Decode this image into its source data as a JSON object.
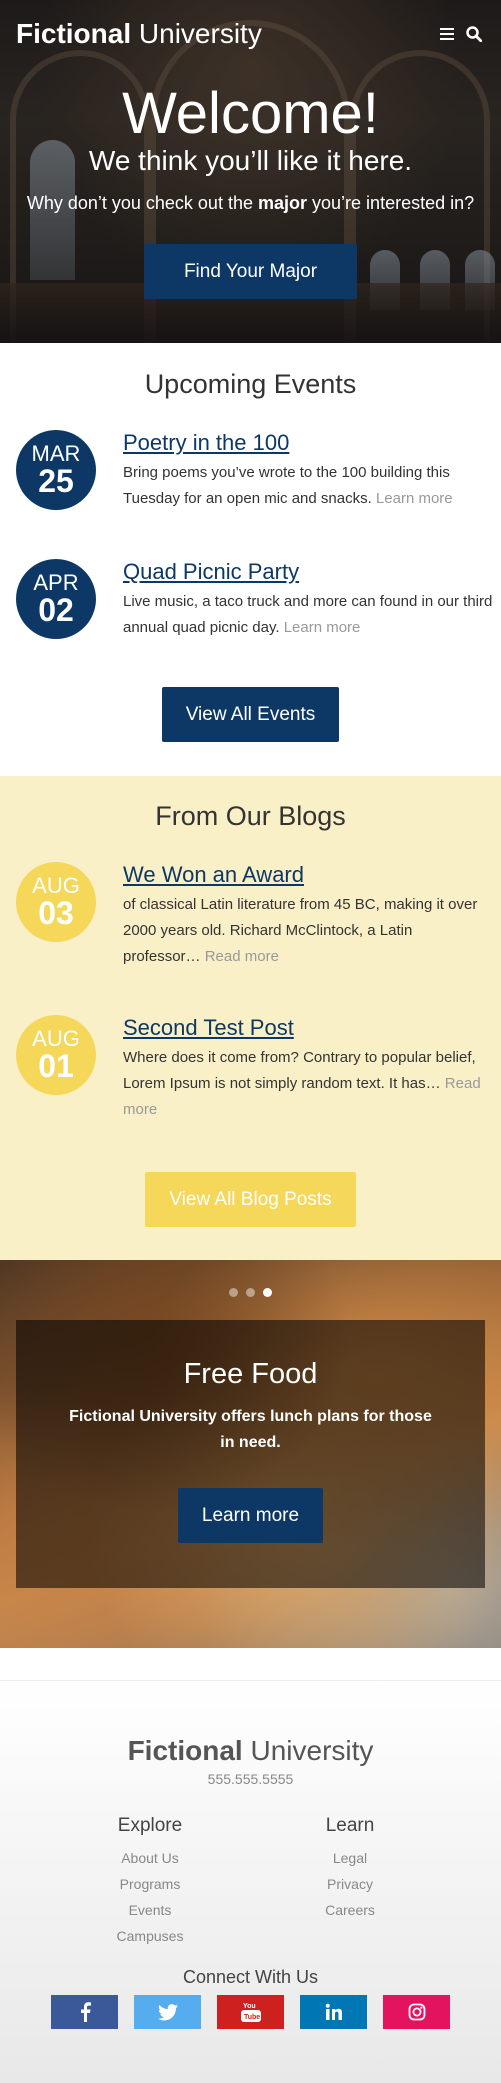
{
  "header": {
    "logo_bold": "Fictional",
    "logo_light": "University",
    "menu_icon": "hamburger-icon",
    "search_icon": "search-icon"
  },
  "hero": {
    "title": "Welcome!",
    "subtitle": "We think you’ll like it here.",
    "question_pre": "Why don’t you check out the",
    "question_bold": "major",
    "question_post": "you’re interested in?",
    "button": "Find Your Major"
  },
  "events": {
    "title": "Upcoming Events",
    "items": [
      {
        "month": "MAR",
        "day": "25",
        "title": "Poetry in the 100",
        "text": "Bring poems you’ve wrote to the 100 building this Tuesday for an open mic and snacks.",
        "more": "Learn more"
      },
      {
        "month": "APR",
        "day": "02",
        "title": "Quad Picnic Party",
        "text": "Live music, a taco truck and more can found in our third annual quad picnic day.",
        "more": "Learn more"
      }
    ],
    "button": "View All Events"
  },
  "blogs": {
    "title": "From Our Blogs",
    "items": [
      {
        "month": "AUG",
        "day": "03",
        "title": "We Won an Award",
        "text": "of classical Latin literature from 45 BC, making it over 2000 years old. Richard McClintock, a Latin professor…",
        "more": "Read more"
      },
      {
        "month": "AUG",
        "day": "01",
        "title": "Second Test Post",
        "text": "Where does it come from? Contrary to popular belief, Lorem Ipsum is not simply random text. It has…",
        "more": "Read more"
      }
    ],
    "button": "View All Blog Posts"
  },
  "slider": {
    "active_slide": 3,
    "slide_count": 3,
    "title": "Free Food",
    "text": "Fictional University offers lunch plans for those in need.",
    "button": "Learn more"
  },
  "footer": {
    "logo_bold": "Fictional",
    "logo_light": "University",
    "phone": "555.555.5555",
    "explore": {
      "title": "Explore",
      "links": [
        "About Us",
        "Programs",
        "Events",
        "Campuses"
      ]
    },
    "learn": {
      "title": "Learn",
      "links": [
        "Legal",
        "Privacy",
        "Careers"
      ]
    },
    "connect": "Connect With Us",
    "social": [
      {
        "name": "facebook-icon",
        "glyph": "f",
        "color": "#3b5998"
      },
      {
        "name": "twitter-icon",
        "glyph": "t",
        "color": "#55acee"
      },
      {
        "name": "youtube-icon",
        "glyph": "▶",
        "color": "#cd201f"
      },
      {
        "name": "linkedin-icon",
        "glyph": "in",
        "color": "#0077b5"
      },
      {
        "name": "instagram-icon",
        "glyph": "◎",
        "color": "#e4405f"
      }
    ]
  },
  "colors": {
    "brand_blue": "#0d3865",
    "brand_yellow": "#f5d759",
    "blog_bg": "#faf0c8"
  }
}
